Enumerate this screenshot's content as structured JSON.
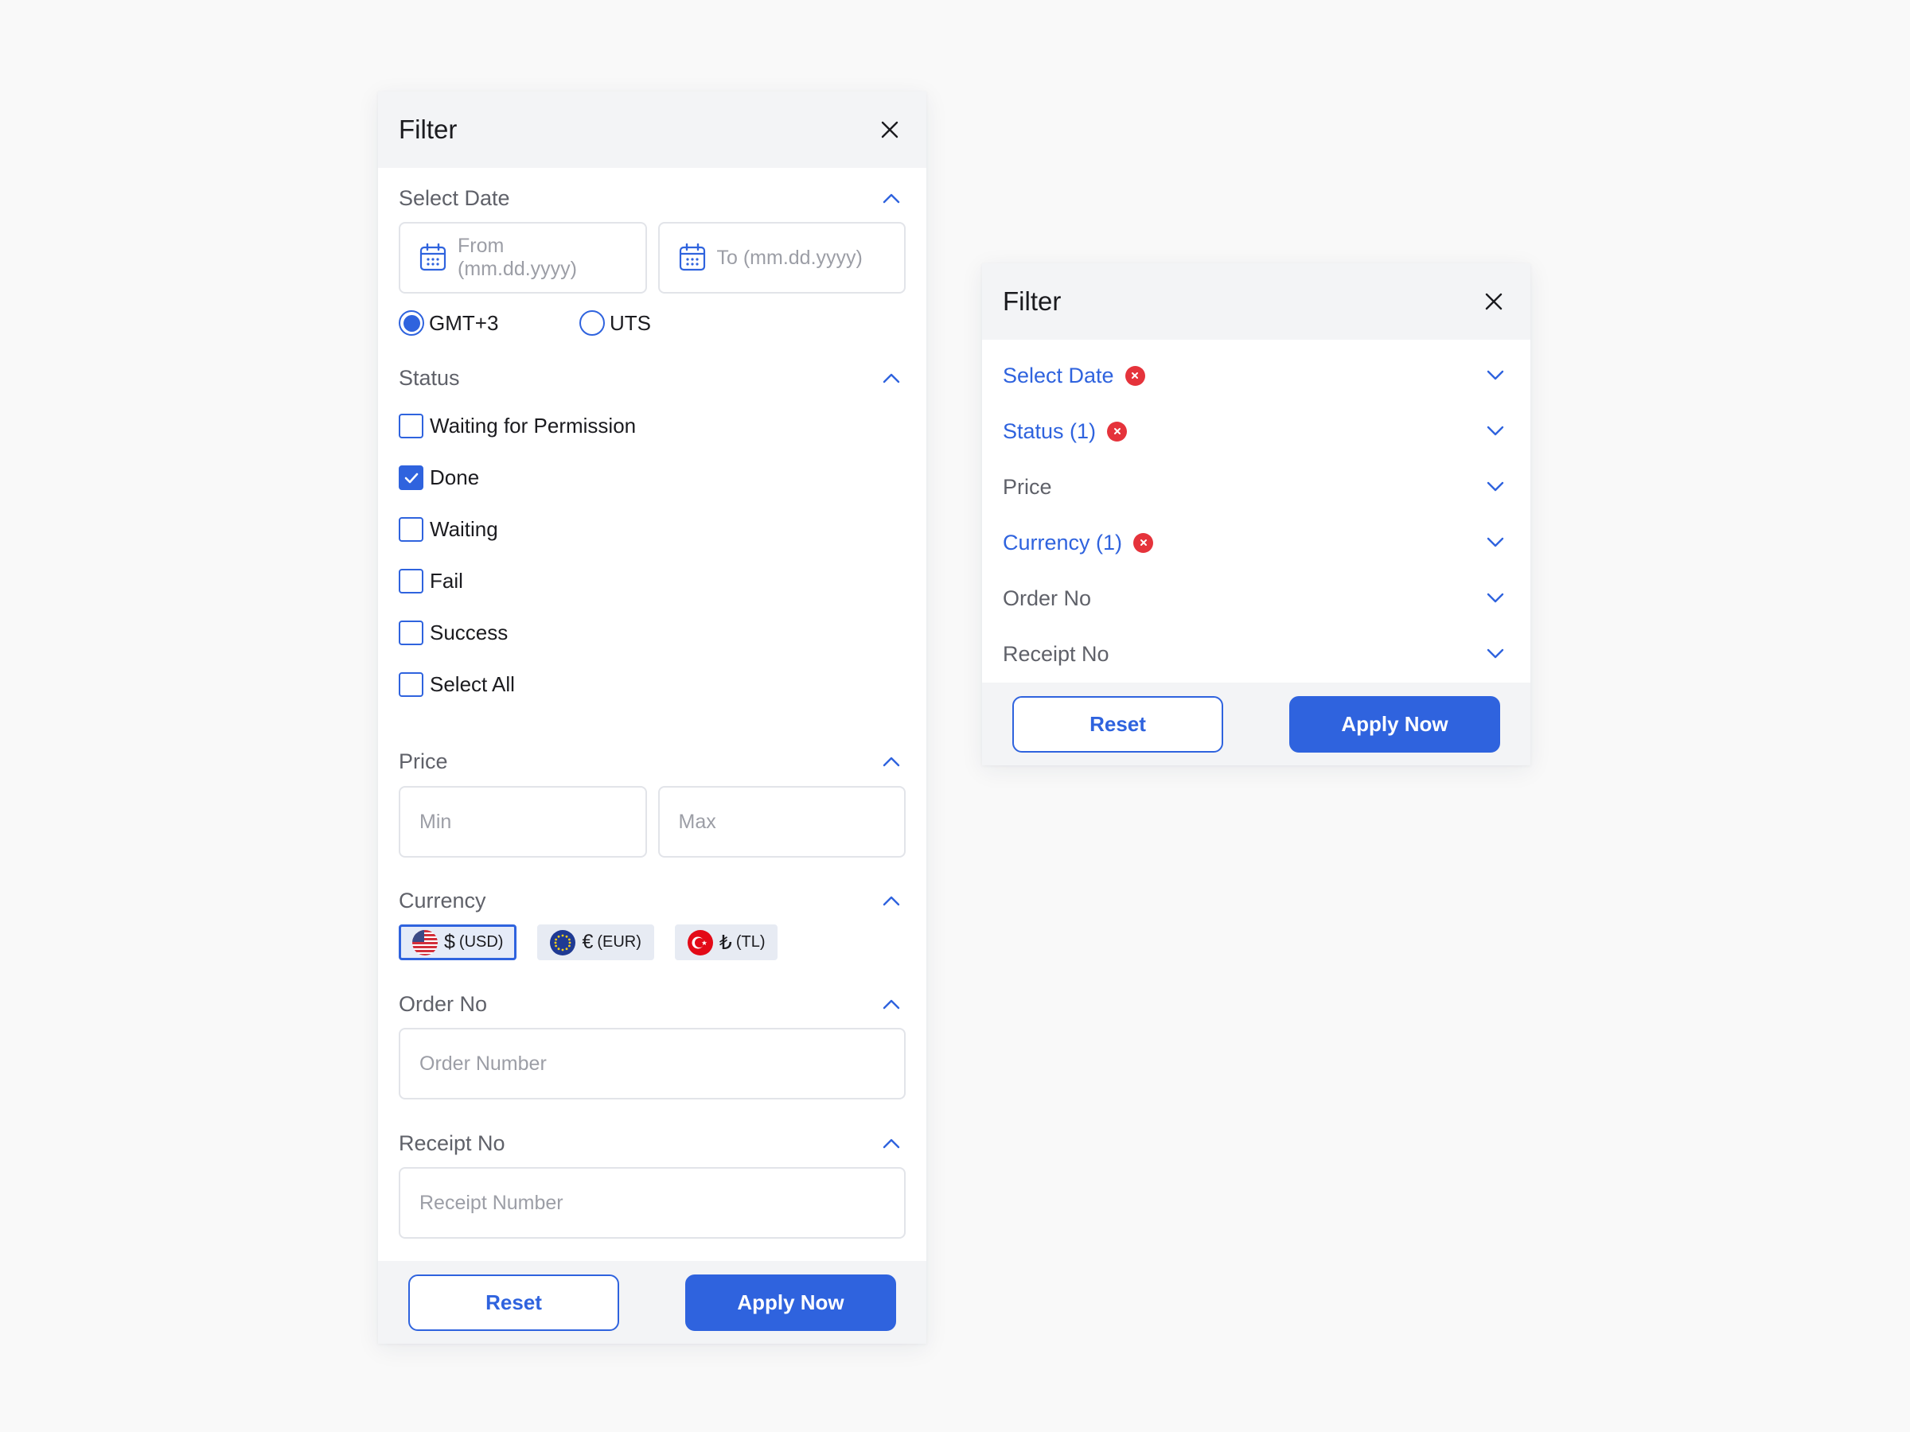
{
  "left_panel": {
    "title": "Filter",
    "select_date": {
      "title": "Select Date",
      "from_placeholder": "From (mm.dd.yyyy)",
      "to_placeholder": "To (mm.dd.yyyy)"
    },
    "timezone": {
      "options": [
        {
          "label": "GMT+3",
          "selected": true
        },
        {
          "label": "UTS",
          "selected": false
        }
      ]
    },
    "status": {
      "title": "Status",
      "items": [
        {
          "label": "Waiting for Permission",
          "checked": false
        },
        {
          "label": "Done",
          "checked": true
        },
        {
          "label": "Waiting",
          "checked": false
        },
        {
          "label": "Fail",
          "checked": false
        },
        {
          "label": "Success",
          "checked": false
        },
        {
          "label": "Select All",
          "checked": false
        }
      ]
    },
    "price": {
      "title": "Price",
      "min_placeholder": "Min",
      "max_placeholder": "Max"
    },
    "currency": {
      "title": "Currency",
      "options": [
        {
          "symbol": "$",
          "code": "(USD)",
          "flag": "usa-flag-icon",
          "selected": true
        },
        {
          "symbol": "€",
          "code": "(EUR)",
          "flag": "eu-flag-icon",
          "selected": false
        },
        {
          "symbol": "₺",
          "code": "(TL)",
          "flag": "turkey-flag-icon",
          "selected": false
        }
      ]
    },
    "order_no": {
      "title": "Order No",
      "placeholder": "Order Number"
    },
    "receipt_no": {
      "title": "Receipt No",
      "placeholder": "Receipt Number"
    },
    "footer": {
      "reset_label": "Reset",
      "apply_label": "Apply Now"
    }
  },
  "right_panel": {
    "title": "Filter",
    "sections": [
      {
        "label": "Select Date",
        "active": true,
        "clearable": true
      },
      {
        "label": "Status (1)",
        "active": true,
        "clearable": true
      },
      {
        "label": "Price",
        "active": false,
        "clearable": false
      },
      {
        "label": "Currency (1)",
        "active": true,
        "clearable": true
      },
      {
        "label": "Order No",
        "active": false,
        "clearable": false
      },
      {
        "label": "Receipt No",
        "active": false,
        "clearable": false
      }
    ],
    "footer": {
      "reset_label": "Reset",
      "apply_label": "Apply Now"
    }
  },
  "colors": {
    "accent": "#2f63de",
    "danger": "#e5333b",
    "header_bg": "#f3f4f6",
    "page_bg": "#f9f9f9"
  }
}
